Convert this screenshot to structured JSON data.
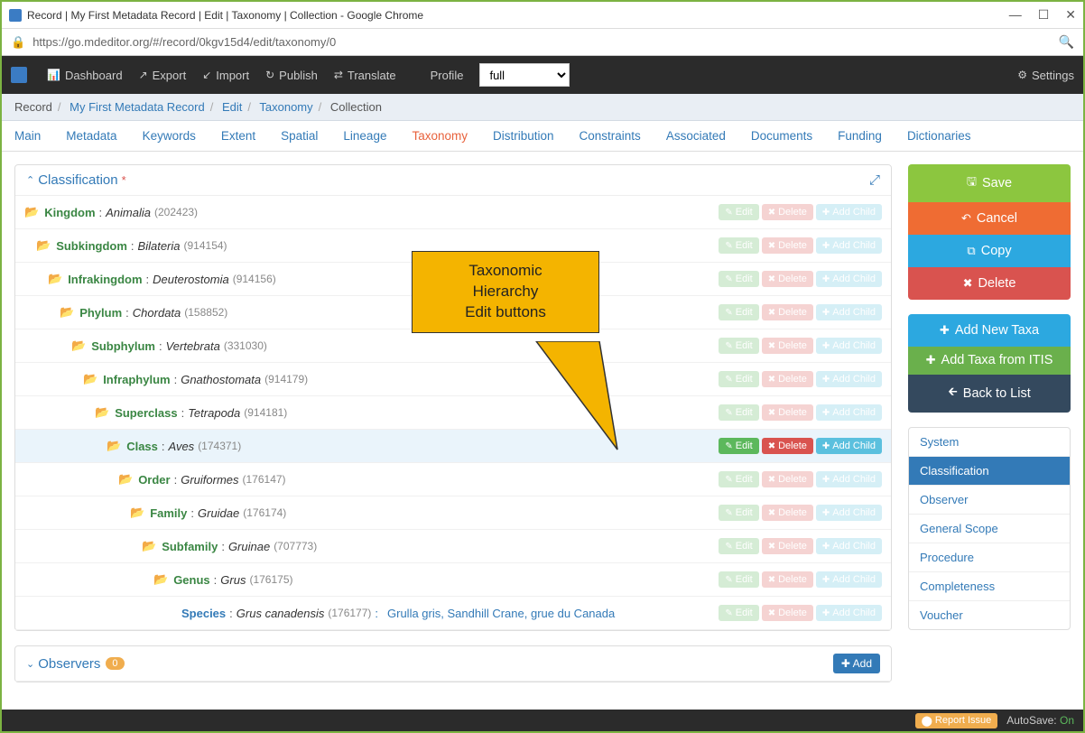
{
  "window": {
    "title": "Record | My First Metadata Record | Edit | Taxonomy | Collection - Google Chrome",
    "url": "https://go.mdeditor.org/#/record/0kgv15d4/edit/taxonomy/0"
  },
  "topnav": {
    "dashboard": "Dashboard",
    "export": "Export",
    "import": "Import",
    "publish": "Publish",
    "translate": "Translate",
    "profile_label": "Profile",
    "profile_value": "full",
    "settings": "Settings"
  },
  "breadcrumb": {
    "record": "Record",
    "recordname": "My First Metadata Record",
    "edit": "Edit",
    "taxonomy": "Taxonomy",
    "collection": "Collection"
  },
  "tabs": [
    "Main",
    "Metadata",
    "Keywords",
    "Extent",
    "Spatial",
    "Lineage",
    "Taxonomy",
    "Distribution",
    "Constraints",
    "Associated",
    "Documents",
    "Funding",
    "Dictionaries"
  ],
  "active_tab": "Taxonomy",
  "panel": {
    "title": "Classification"
  },
  "rows": [
    {
      "indent": 0,
      "rank": "Kingdom",
      "name": "Animalia",
      "code": "202423",
      "active": false,
      "folder": true
    },
    {
      "indent": 1,
      "rank": "Subkingdom",
      "name": "Bilateria",
      "code": "914154",
      "active": false,
      "folder": true
    },
    {
      "indent": 2,
      "rank": "Infrakingdom",
      "name": "Deuterostomia",
      "code": "914156",
      "active": false,
      "folder": true
    },
    {
      "indent": 3,
      "rank": "Phylum",
      "name": "Chordata",
      "code": "158852",
      "active": false,
      "folder": true
    },
    {
      "indent": 4,
      "rank": "Subphylum",
      "name": "Vertebrata",
      "code": "331030",
      "active": false,
      "folder": true
    },
    {
      "indent": 5,
      "rank": "Infraphylum",
      "name": "Gnathostomata",
      "code": "914179",
      "active": false,
      "folder": true
    },
    {
      "indent": 6,
      "rank": "Superclass",
      "name": "Tetrapoda",
      "code": "914181",
      "active": false,
      "folder": true
    },
    {
      "indent": 7,
      "rank": "Class",
      "name": "Aves",
      "code": "174371",
      "active": true,
      "folder": true
    },
    {
      "indent": 8,
      "rank": "Order",
      "name": "Gruiformes",
      "code": "176147",
      "active": false,
      "folder": true
    },
    {
      "indent": 9,
      "rank": "Family",
      "name": "Gruidae",
      "code": "176174",
      "active": false,
      "folder": true
    },
    {
      "indent": 10,
      "rank": "Subfamily",
      "name": "Gruinae",
      "code": "707773",
      "active": false,
      "folder": true
    },
    {
      "indent": 11,
      "rank": "Genus",
      "name": "Grus",
      "code": "176175",
      "active": false,
      "folder": true
    },
    {
      "indent": 12,
      "rank": "Species",
      "name": "Grus canadensis",
      "code": "176177",
      "active": false,
      "folder": false,
      "extra": "Grulla gris, Sandhill Crane, grue du Canada"
    }
  ],
  "row_btns": {
    "edit": "Edit",
    "delete": "Delete",
    "addchild": "Add Child"
  },
  "observers": {
    "title": "Observers",
    "count": "0",
    "add": "Add"
  },
  "sidebar": {
    "save": "Save",
    "cancel": "Cancel",
    "copy": "Copy",
    "delete": "Delete",
    "addtaxa": "Add New Taxa",
    "additis": "Add Taxa from ITIS",
    "back": "Back to List"
  },
  "sidenav": [
    "System",
    "Classification",
    "Observer",
    "General Scope",
    "Procedure",
    "Completeness",
    "Voucher"
  ],
  "sidenav_active": "Classification",
  "callout": {
    "l1": "Taxonomic",
    "l2": "Hierarchy",
    "l3": "Edit buttons"
  },
  "footer": {
    "report": "Report Issue",
    "autosave_label": "AutoSave:",
    "autosave_state": "On"
  }
}
